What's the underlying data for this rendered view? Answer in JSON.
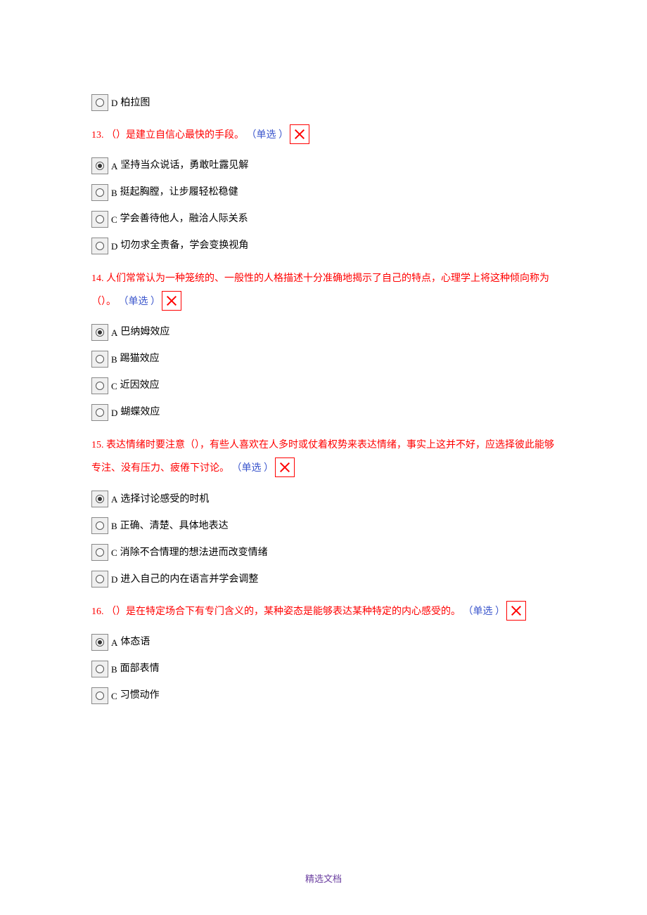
{
  "orphan_option": {
    "letter": "D",
    "text": "柏拉图"
  },
  "questions": [
    {
      "num": "13.",
      "text": "（）是建立自信心最快的手段。",
      "type": "（单选 ）",
      "x": true,
      "options": [
        {
          "letter": "A",
          "text": "坚持当众说话，勇敢吐露见解",
          "selected": true
        },
        {
          "letter": "B",
          "text": "挺起胸膛，让步履轻松稳健",
          "selected": false
        },
        {
          "letter": "C",
          "text": "学会善待他人，融洽人际关系",
          "selected": false
        },
        {
          "letter": "D",
          "text": "切勿求全责备，学会变换视角",
          "selected": false
        }
      ]
    },
    {
      "num": "14.",
      "text": "人们常常认为一种笼统的、一般性的人格描述十分准确地揭示了自己的特点，心理学上将这种倾向称为（）。",
      "type": "（单选 ）",
      "x": true,
      "options": [
        {
          "letter": "A",
          "text": "巴纳姆效应",
          "selected": true
        },
        {
          "letter": "B",
          "text": "踢猫效应",
          "selected": false
        },
        {
          "letter": "C",
          "text": "近因效应",
          "selected": false
        },
        {
          "letter": "D",
          "text": "蝴蝶效应",
          "selected": false
        }
      ]
    },
    {
      "num": "15.",
      "text": "表达情绪时要注意（），有些人喜欢在人多时或仗着权势来表达情绪，事实上这并不好，应选择彼此能够专注、没有压力、疲倦下讨论。",
      "type": "（单选 ）",
      "x": true,
      "options": [
        {
          "letter": "A",
          "text": "选择讨论感受的时机",
          "selected": true
        },
        {
          "letter": "B",
          "text": "正确、清楚、具体地表达",
          "selected": false
        },
        {
          "letter": "C",
          "text": "消除不合情理的想法进而改变情绪",
          "selected": false
        },
        {
          "letter": "D",
          "text": "进入自己的内在语言并学会调整",
          "selected": false
        }
      ]
    },
    {
      "num": "16.",
      "text": "（）是在特定场合下有专门含义的，某种姿态是能够表达某种特定的内心感受的。",
      "type": "（单选 ）",
      "x": true,
      "options": [
        {
          "letter": "A",
          "text": "体态语",
          "selected": true
        },
        {
          "letter": "B",
          "text": "面部表情",
          "selected": false
        },
        {
          "letter": "C",
          "text": "习惯动作",
          "selected": false
        }
      ]
    }
  ],
  "footer": "精选文档"
}
